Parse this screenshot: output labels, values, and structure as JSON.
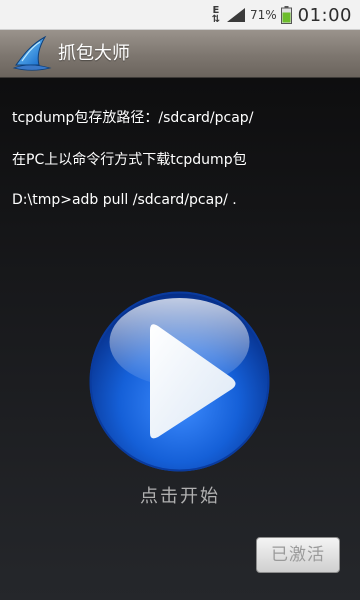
{
  "status_bar": {
    "network_type": [
      "E",
      "⇅"
    ],
    "battery_percent": "71%",
    "time": "01:00",
    "colors": {
      "battery_level": "#6dbd2b"
    }
  },
  "app": {
    "title": "抓包大师",
    "icon": "shark-fin-icon"
  },
  "info": {
    "storage_path": "tcpdump包存放路径：/sdcard/pcap/",
    "download_hint": "在PC上以命令行方式下载tcpdump包",
    "command": "D:\\tmp>adb pull /sdcard/pcap/ ."
  },
  "main": {
    "play_icon": "play-icon",
    "start_label": "点击开始",
    "activated_label": "已激活",
    "colors": {
      "play_blue": "#1560d8"
    }
  }
}
